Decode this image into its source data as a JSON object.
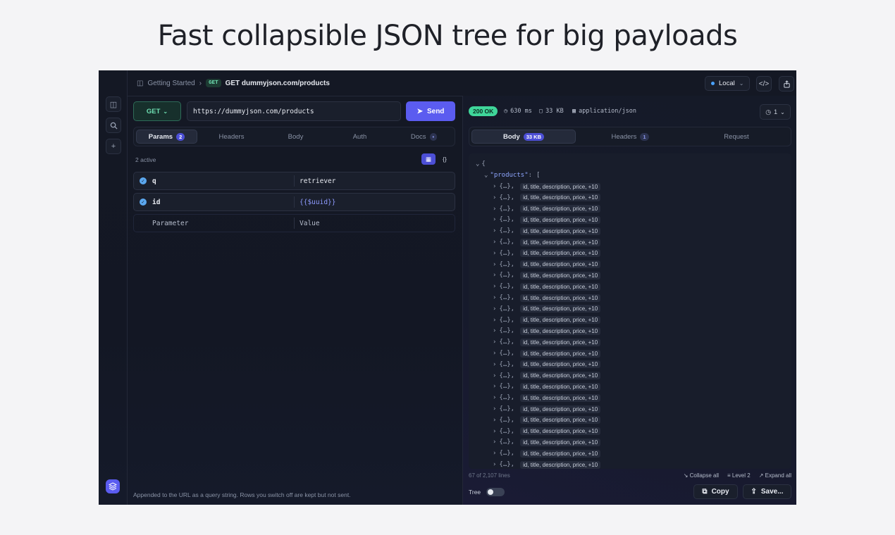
{
  "hero_title": "Fast collapsible JSON tree for big payloads",
  "colors": {
    "accent": "#5b5cf0",
    "success": "#3fd69a",
    "get_method": "#6fe0b3"
  },
  "topbar": {
    "breadcrumb_root": "Getting Started",
    "breadcrumb_method": "GET",
    "breadcrumb_request": "GET dummyjson.com/products",
    "environment": "Local"
  },
  "request": {
    "method": "GET",
    "url": "https://dummyjson.com/products",
    "send_label": "Send",
    "tabs": [
      {
        "label": "Params",
        "count": "2"
      },
      {
        "label": "Headers"
      },
      {
        "label": "Body"
      },
      {
        "label": "Auth"
      },
      {
        "label": "Docs",
        "count": "•"
      }
    ],
    "active_summary": "2 active",
    "params": [
      {
        "key": "q",
        "value": "retriever"
      },
      {
        "key": "id",
        "value": "{{$uuid}}"
      }
    ],
    "param_placeholder_key": "Parameter",
    "param_placeholder_value": "Value",
    "footnote": "Appended to the URL as a query string. Rows you switch off are kept but not sent."
  },
  "response": {
    "status": "200 OK",
    "time": "630 ms",
    "size": "33 KB",
    "content_type": "application/json",
    "history_count": "1",
    "tabs": [
      {
        "label": "Body",
        "count": "33 KB"
      },
      {
        "label": "Headers",
        "count": "1"
      },
      {
        "label": "Request"
      }
    ],
    "tree": {
      "root_open": "{",
      "products_key": "\"products\"",
      "products_colon": ":",
      "products_open": "[",
      "item_text": "{…},",
      "item_summary": "id, title, description, price, +10",
      "visible_items": 26
    },
    "lines_info": "67 of 2,107 lines",
    "collapse_all": "Collapse all",
    "level": "Level 2",
    "expand_all": "Expand all",
    "tree_label": "Tree",
    "copy_label": "Copy",
    "save_label": "Save..."
  }
}
